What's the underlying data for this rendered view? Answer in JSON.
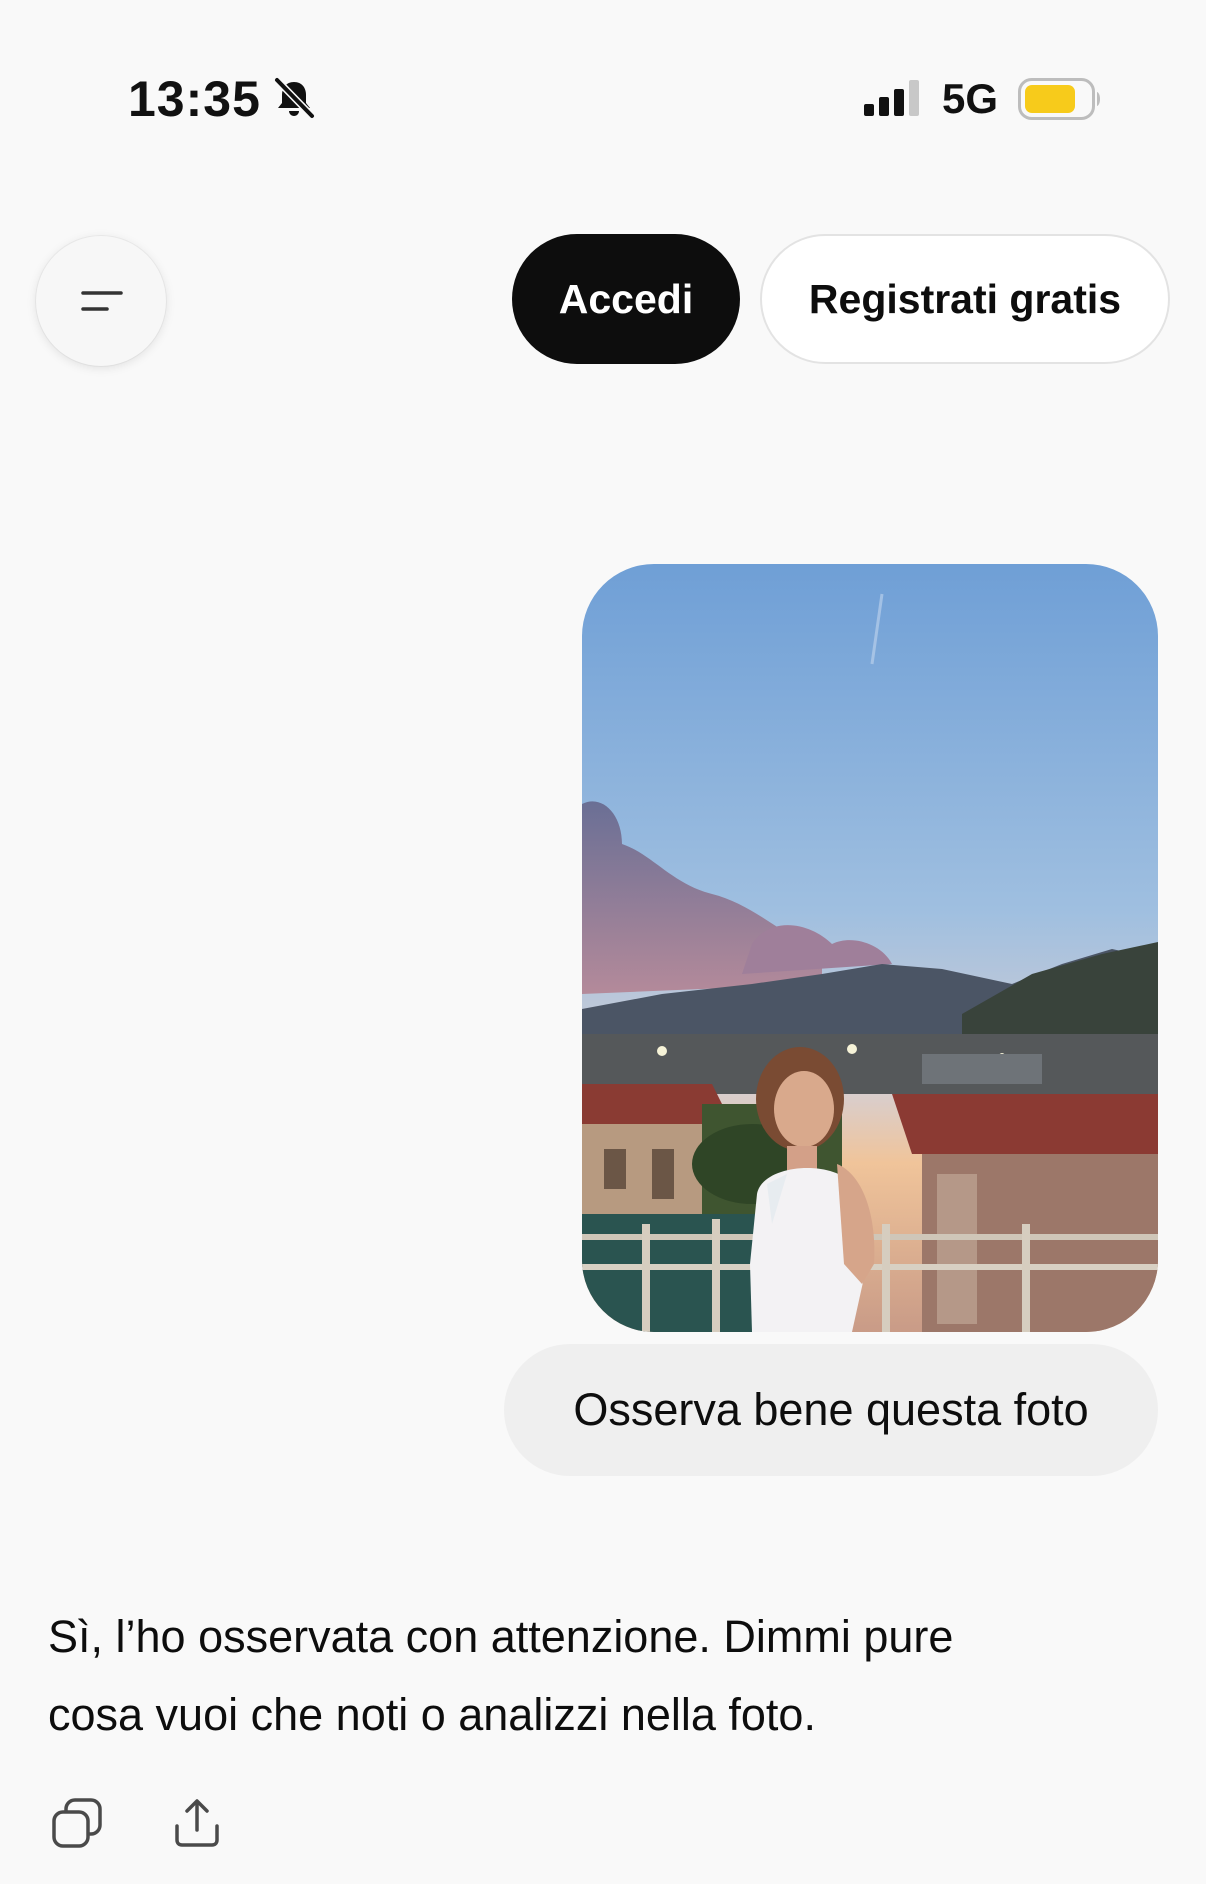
{
  "status_bar": {
    "time": "13:35",
    "network": "5G",
    "mute_icon": "bell-slash-icon",
    "signal_icon": "cellular-signal-icon",
    "battery_icon": "battery-icon",
    "battery_color": "#f7cb1b"
  },
  "header": {
    "menu_icon": "menu-lines-icon",
    "login_label": "Accedi",
    "signup_label": "Registrati gratis"
  },
  "chat": {
    "user_image_alt": "photo",
    "user_message": "Osserva bene questa foto",
    "assistant_message": "Sì, l’ho osservata con attenzione. Dimmi pure cosa vuoi che noti o analizzi nella foto.",
    "actions": {
      "copy_icon": "copy-icon",
      "share_icon": "share-icon"
    }
  },
  "colors": {
    "background": "#f9f9f9",
    "primary_button": "#0d0d0d",
    "bubble": "#efefef"
  }
}
